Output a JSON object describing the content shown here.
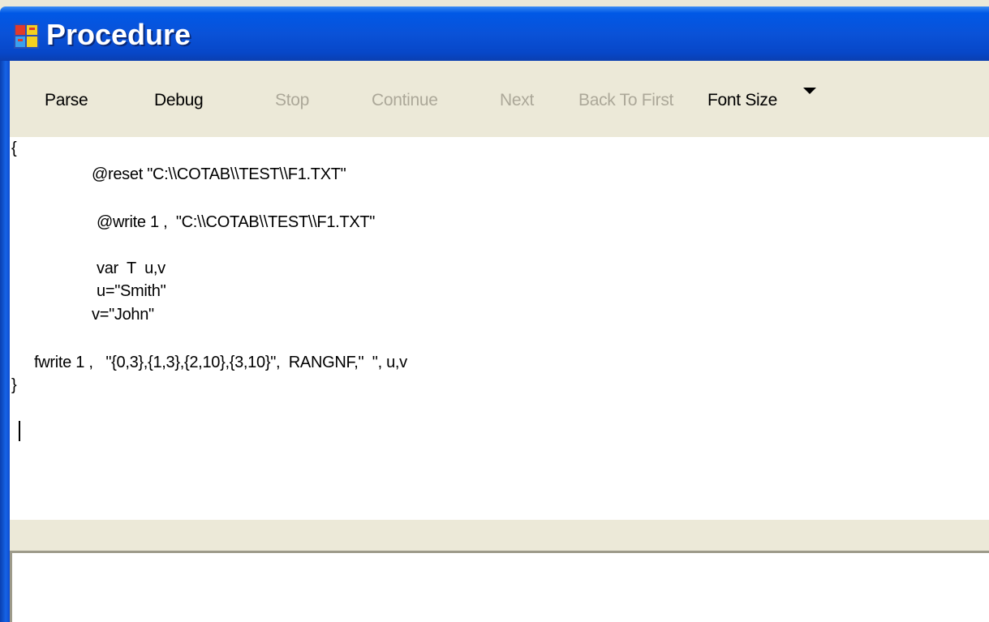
{
  "window": {
    "title": "Procedure",
    "icon": "procedure-app-icon"
  },
  "toolbar": {
    "parse": "Parse",
    "debug": "Debug",
    "stop": "Stop",
    "continue": "Continue",
    "next": "Next",
    "back_to_first": "Back To First",
    "font_size": "Font Size",
    "font_size_icon": "chevron-down-icon"
  },
  "editor": {
    "lines": [
      "{",
      "@reset \"C:\\\\COTAB\\\\TEST\\\\F1.TXT\"",
      "@write 1 ,  \"C:\\\\COTAB\\\\TEST\\\\F1.TXT\"",
      "var  T  u,v",
      "u=\"Smith\"",
      "v=\"John\"",
      "fwrite 1 ,   \"{0,3},{1,3},{2,10},{3,10}\",  RANGNF,\"  \", u,v",
      "}"
    ]
  },
  "output": {
    "text": ""
  },
  "colors": {
    "title_bar": "#0a52d8",
    "toolbar_bg": "#ece9d8",
    "disabled_text": "#aca899"
  }
}
